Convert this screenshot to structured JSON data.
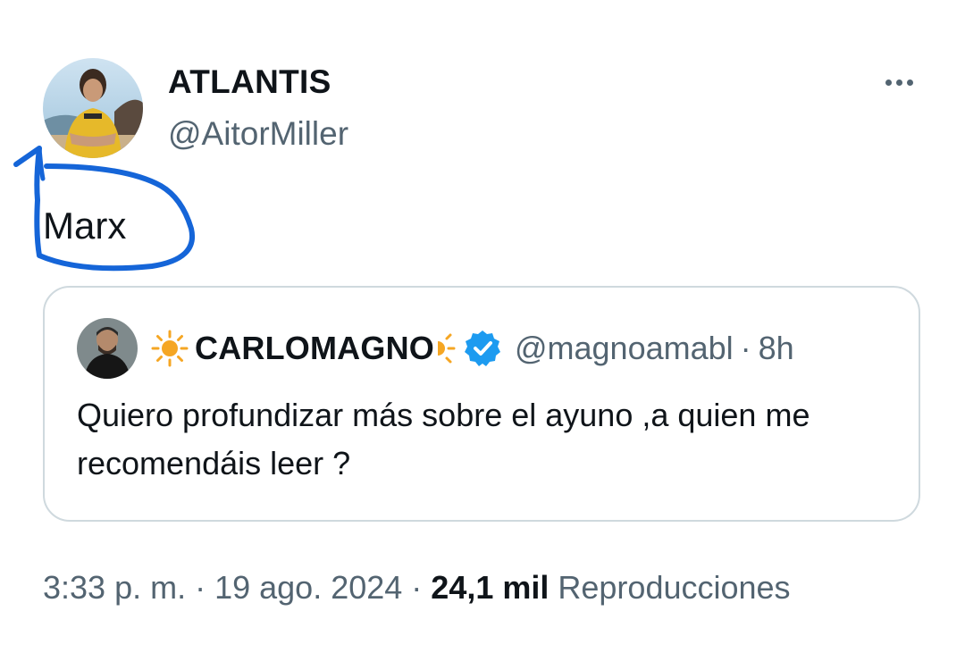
{
  "tweet": {
    "author_name": "ATLANTIS",
    "author_handle": "@AitorMiller",
    "text": "Marx",
    "more_icon": "more-horizontal-icon"
  },
  "quote": {
    "name": "CARLOMAGNO",
    "name_prefix_icon": "sun-icon",
    "name_suffix_icon": "sun-half-icon",
    "verified_icon": "verified-badge-icon",
    "verified_color": "#1d9bf0",
    "handle": "@magnoamabl",
    "separator": "·",
    "time": "8h",
    "text": "Quiero profundizar más sobre el ayuno ,a quien me recomendáis leer ?"
  },
  "meta": {
    "time": "3:33 p. m.",
    "sep1": " · ",
    "date": "19 ago. 2024",
    "sep2": " · ",
    "views_count": "24,1 mil",
    "views_label": " Reproducciones"
  },
  "annotation": {
    "scribble_color": "#1565d8"
  }
}
